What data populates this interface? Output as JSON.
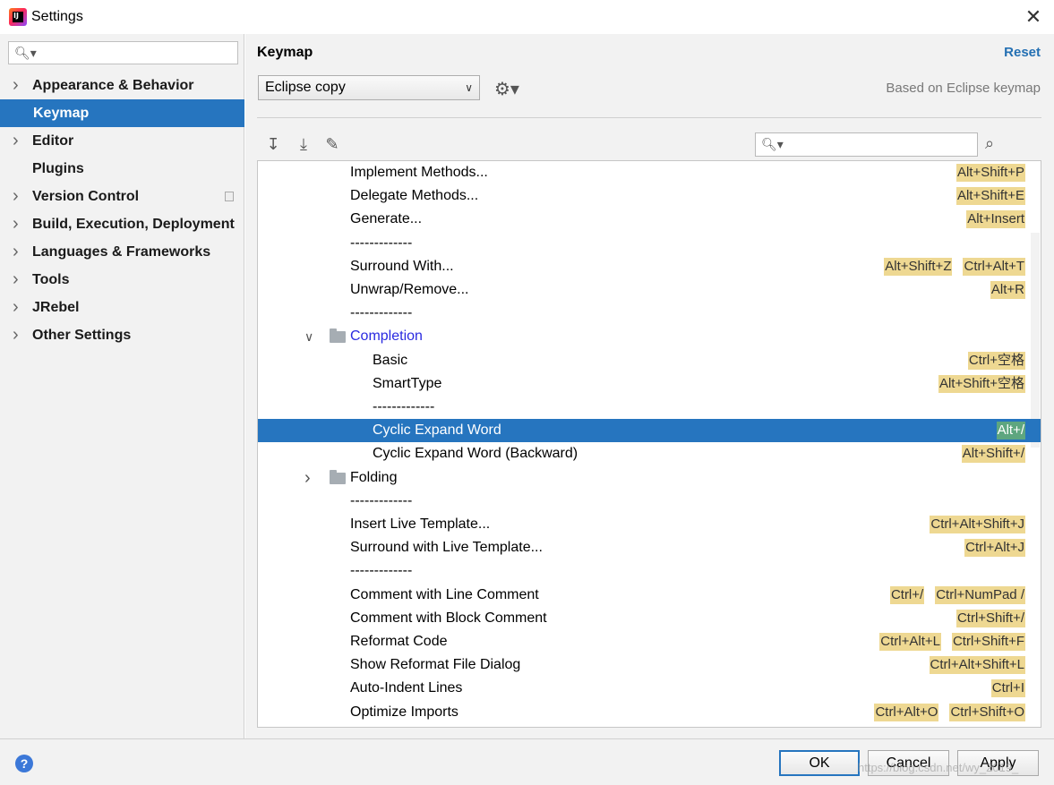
{
  "window": {
    "title": "Settings",
    "app_icon": "intellij-idea-icon",
    "close_glyph": "✕"
  },
  "sidebar": {
    "search": {
      "value": ""
    },
    "items": [
      {
        "label": "Appearance & Behavior",
        "expandable": true
      },
      {
        "label": "Keymap",
        "selected": true
      },
      {
        "label": "Editor",
        "expandable": true
      },
      {
        "label": "Plugins"
      },
      {
        "label": "Version Control",
        "expandable": true,
        "has_copy_icon": true
      },
      {
        "label": "Build, Execution, Deployment",
        "expandable": true
      },
      {
        "label": "Languages & Frameworks",
        "expandable": true
      },
      {
        "label": "Tools",
        "expandable": true
      },
      {
        "label": "JRebel",
        "expandable": true
      },
      {
        "label": "Other Settings",
        "expandable": true
      }
    ]
  },
  "main": {
    "title": "Keymap",
    "reset": "Reset",
    "keymap_select": {
      "value": "Eclipse copy"
    },
    "based_on": "Based on Eclipse keymap",
    "find": {
      "value": ""
    }
  },
  "tree": {
    "rows": [
      {
        "label": "Implement Methods...",
        "indent": 1,
        "shortcuts": [
          "Alt+Shift+P"
        ]
      },
      {
        "label": "Delegate Methods...",
        "indent": 1,
        "shortcuts": [
          "Alt+Shift+E"
        ]
      },
      {
        "label": "Generate...",
        "indent": 1,
        "shortcuts": [
          "Alt+Insert"
        ]
      },
      {
        "label": "-------------",
        "indent": 1,
        "shortcuts": []
      },
      {
        "label": "Surround With...",
        "indent": 1,
        "shortcuts": [
          "Alt+Shift+Z",
          "Ctrl+Alt+T"
        ]
      },
      {
        "label": "Unwrap/Remove...",
        "indent": 1,
        "shortcuts": [
          "Alt+R"
        ]
      },
      {
        "label": "-------------",
        "indent": 1,
        "shortcuts": []
      },
      {
        "label": "Completion",
        "indent": 1,
        "folder": true,
        "expanded": true,
        "group": true,
        "shortcuts": []
      },
      {
        "label": "Basic",
        "indent": 2,
        "shortcuts": [
          "Ctrl+空格"
        ]
      },
      {
        "label": "SmartType",
        "indent": 2,
        "shortcuts": [
          "Alt+Shift+空格"
        ]
      },
      {
        "label": "-------------",
        "indent": 2,
        "shortcuts": []
      },
      {
        "label": "Cyclic Expand Word",
        "indent": 2,
        "selected": true,
        "shortcuts": [
          "Alt+/"
        ]
      },
      {
        "label": "Cyclic Expand Word (Backward)",
        "indent": 2,
        "shortcuts": [
          "Alt+Shift+/"
        ]
      },
      {
        "label": "Folding",
        "indent": 1,
        "folder": true,
        "expanded": false,
        "shortcuts": []
      },
      {
        "label": "-------------",
        "indent": 1,
        "shortcuts": []
      },
      {
        "label": "Insert Live Template...",
        "indent": 1,
        "shortcuts": [
          "Ctrl+Alt+Shift+J"
        ]
      },
      {
        "label": "Surround with Live Template...",
        "indent": 1,
        "shortcuts": [
          "Ctrl+Alt+J"
        ]
      },
      {
        "label": "-------------",
        "indent": 1,
        "shortcuts": []
      },
      {
        "label": "Comment with Line Comment",
        "indent": 1,
        "shortcuts": [
          "Ctrl+/",
          "Ctrl+NumPad /"
        ]
      },
      {
        "label": "Comment with Block Comment",
        "indent": 1,
        "shortcuts": [
          "Ctrl+Shift+/"
        ]
      },
      {
        "label": "Reformat Code",
        "indent": 1,
        "shortcuts": [
          "Ctrl+Alt+L",
          "Ctrl+Shift+F"
        ]
      },
      {
        "label": "Show Reformat File Dialog",
        "indent": 1,
        "shortcuts": [
          "Ctrl+Alt+Shift+L"
        ]
      },
      {
        "label": "Auto-Indent Lines",
        "indent": 1,
        "shortcuts": [
          "Ctrl+I"
        ]
      },
      {
        "label": "Optimize Imports",
        "indent": 1,
        "shortcuts": [
          "Ctrl+Alt+O",
          "Ctrl+Shift+O"
        ]
      }
    ]
  },
  "footer": {
    "help": "?",
    "ok": "OK",
    "cancel": "Cancel",
    "apply": "Apply",
    "watermark": "https://blog.csdn.net/wy_2019_"
  },
  "colors": {
    "selection": "#2675bf",
    "shortcut_bg": "#eed892",
    "link": "#2470b3"
  }
}
